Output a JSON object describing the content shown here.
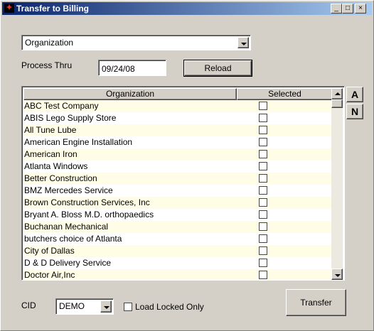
{
  "window": {
    "title": "Transfer to Billing",
    "icon_glyph": "✦",
    "controls": {
      "minimize": "_",
      "maximize": "□",
      "close": "×"
    }
  },
  "filter_combo": {
    "value": "Organization"
  },
  "process_thru": {
    "label": "Process Thru",
    "value": "09/24/08"
  },
  "reload_button": {
    "label": "Reload"
  },
  "grid": {
    "columns": [
      "Organization",
      "Selected"
    ],
    "rows": [
      {
        "name": "ABC Test Company",
        "selected": false
      },
      {
        "name": "ABIS Lego Supply Store",
        "selected": false
      },
      {
        "name": "All Tune Lube",
        "selected": false
      },
      {
        "name": "American Engine Installation",
        "selected": false
      },
      {
        "name": "American Iron",
        "selected": false
      },
      {
        "name": "Atlanta Windows",
        "selected": false
      },
      {
        "name": "Better Construction",
        "selected": false
      },
      {
        "name": "BMZ Mercedes Service",
        "selected": false
      },
      {
        "name": "Brown Construction Services, Inc",
        "selected": false
      },
      {
        "name": "Bryant A. Bloss M.D. orthopaedics",
        "selected": false
      },
      {
        "name": "Buchanan Mechanical",
        "selected": false
      },
      {
        "name": "butchers choice of Atlanta",
        "selected": false
      },
      {
        "name": "City of Dallas",
        "selected": false
      },
      {
        "name": "D & D Delivery Service",
        "selected": false
      },
      {
        "name": "Doctor Air,Inc",
        "selected": false
      }
    ]
  },
  "side_buttons": {
    "a": "A",
    "n": "N"
  },
  "cid": {
    "label": "CID",
    "value": "DEMO"
  },
  "load_locked": {
    "label": "Load Locked Only",
    "checked": false
  },
  "transfer_button": {
    "label": "Transfer"
  }
}
